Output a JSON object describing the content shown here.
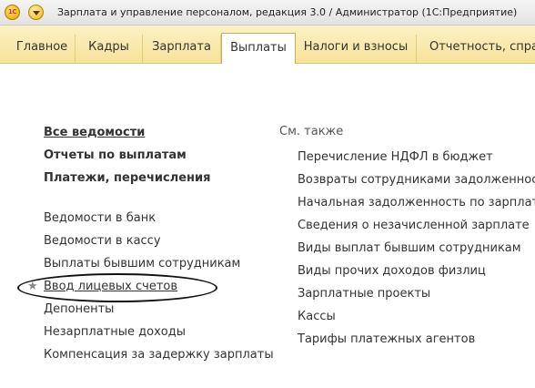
{
  "titlebar": {
    "logo_text": "1С",
    "title": "Зарплата и управление персоналом, редакция 3.0 / Администратор  (1С:Предприятие)"
  },
  "menu": {
    "tabs": [
      "Главное",
      "Кадры",
      "Зарплата",
      "Выплаты",
      "Налоги и взносы",
      "Отчетность, справк"
    ],
    "active_tab": "Выплаты"
  },
  "left": {
    "bold_links": [
      "Все ведомости",
      "Отчеты по выплатам",
      "Платежи, перечисления"
    ],
    "links": [
      "Ведомости в банк",
      "Ведомости в кассу",
      "Выплаты бывшим сотрудникам",
      "Ввод лицевых счетов",
      "Депоненты",
      "Незарплатные доходы",
      "Компенсация за задержку зарплаты"
    ]
  },
  "right": {
    "see_also": "См. также",
    "links": [
      "Перечисление НДФЛ в бюджет",
      "Возвраты сотрудниками задолженности",
      "Начальная задолженность по зарплате",
      "Сведения о незачисленной зарплате",
      "Виды выплат бывшим сотрудникам",
      "Виды прочих доходов физлиц",
      "Зарплатные проекты",
      "Кассы",
      "Тарифы платежных агентов"
    ]
  },
  "favorite_star": "★",
  "colors": {
    "menu_bg": "#f6e39a",
    "active_tab_bg": "#ffffff",
    "highlight_ellipse": "#111111"
  }
}
